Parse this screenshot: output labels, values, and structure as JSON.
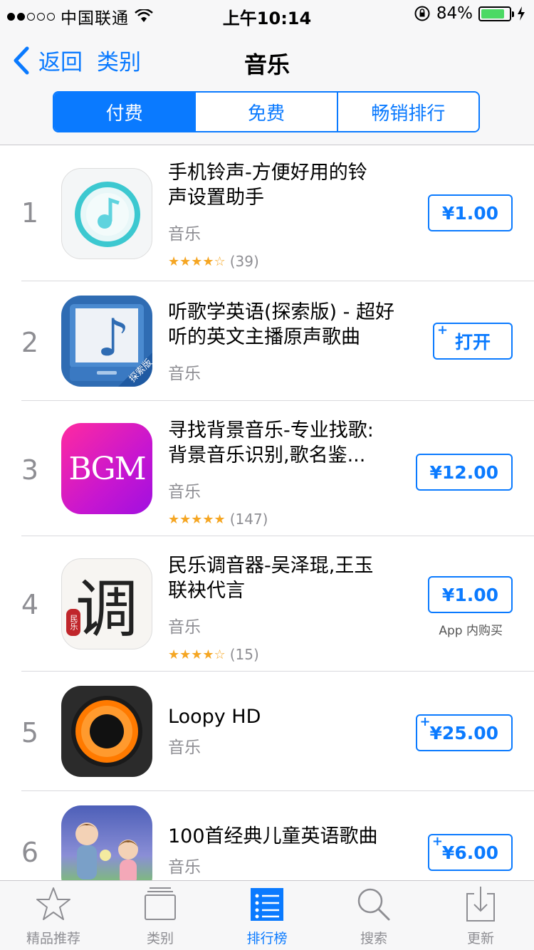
{
  "status_bar": {
    "carrier": "中国联通",
    "time": "上午10:14",
    "battery": "84%"
  },
  "nav": {
    "back_label": "返回",
    "category_label": "类别",
    "title": "音乐",
    "segments": [
      "付费",
      "免费",
      "畅销排行"
    ],
    "active_segment": 0
  },
  "apps": [
    {
      "rank": "1",
      "title_line1": "手机铃声-方便好用的铃",
      "title_line2": "声设置助手",
      "category": "音乐",
      "stars": "★★★★☆",
      "rating_count": "(39)",
      "price": "¥1.00",
      "plus": false,
      "iap": ""
    },
    {
      "rank": "2",
      "title_line1": "听歌学英语(探索版) - 超好",
      "title_line2": "听的英文主播原声歌曲",
      "category": "音乐",
      "stars": "",
      "rating_count": "",
      "price": "打开",
      "plus": true,
      "iap": "",
      "icon_badge": "探索版"
    },
    {
      "rank": "3",
      "title_line1": "寻找背景音乐-专业找歌:",
      "title_line2": "背景音乐识别,歌名鉴...",
      "category": "音乐",
      "stars": "★★★★★",
      "rating_count": "(147)",
      "price": "¥12.00",
      "plus": false,
      "iap": "",
      "icon_text": "BGM"
    },
    {
      "rank": "4",
      "title_line1": "民乐调音器-吴泽琨,王玉",
      "title_line2": "联袂代言",
      "category": "音乐",
      "stars": "★★★★☆",
      "rating_count": "(15)",
      "price": "¥1.00",
      "plus": false,
      "iap": "App 内购买",
      "icon_text": "调",
      "icon_seal": "民乐"
    },
    {
      "rank": "5",
      "title_line1": "Loopy HD",
      "title_line2": "",
      "category": "音乐",
      "stars": "",
      "rating_count": "",
      "price": "¥25.00",
      "plus": true,
      "iap": ""
    },
    {
      "rank": "6",
      "title_line1": "100首经典儿童英语歌曲",
      "title_line2": "",
      "category": "音乐",
      "stars": "",
      "rating_count": "",
      "price": "¥6.00",
      "plus": true,
      "iap": ""
    }
  ],
  "tabs": [
    {
      "label": "精品推荐",
      "icon": "star-icon"
    },
    {
      "label": "类别",
      "icon": "categories-icon"
    },
    {
      "label": "排行榜",
      "icon": "top-charts-icon"
    },
    {
      "label": "搜索",
      "icon": "search-icon"
    },
    {
      "label": "更新",
      "icon": "updates-icon"
    }
  ],
  "active_tab": 2,
  "colors": {
    "accent": "#0a7aff",
    "battery": "#4cd964",
    "star": "#f5a623"
  }
}
